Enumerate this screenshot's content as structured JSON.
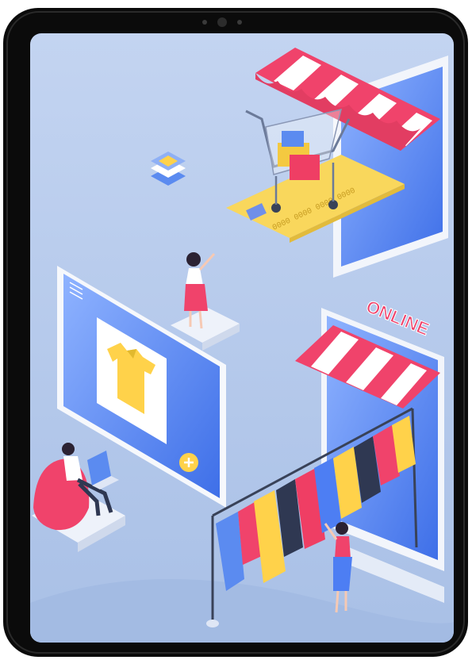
{
  "scene": {
    "sign_text": "ONLINE",
    "card_number": "0000 0000 0000 0000"
  },
  "colors": {
    "frame": "#0b0b0b",
    "screen_bg": "#b8cdee",
    "floor": "#aec4e8",
    "stripe_red": "#f0436b",
    "stripe_white": "#ffffff",
    "blue_panel": "#4d7ef3",
    "yellow": "#ffd24a",
    "card_yellow": "#f9d75c"
  },
  "icons": [
    "camera-icon",
    "shopping-cart-icon",
    "shirt-icon",
    "plus-icon",
    "laptop-icon",
    "stack-icon"
  ]
}
